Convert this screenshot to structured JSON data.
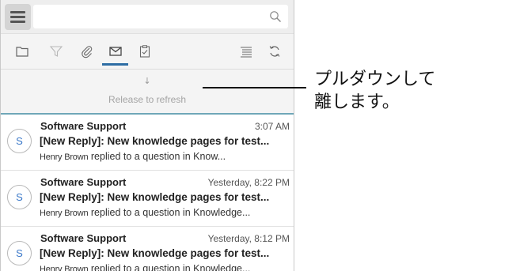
{
  "search": {
    "placeholder": ""
  },
  "toolbar": {
    "icons": [
      "folder-icon",
      "filter-icon",
      "paperclip-icon",
      "envelope-icon",
      "clipboard-icon",
      "list-icon",
      "refresh-icon"
    ],
    "active_tab": "envelope-icon",
    "accent": "#2e6da4"
  },
  "pull_to_refresh": {
    "arrow": "↓",
    "label": "Release to refresh",
    "divider_color": "#6fa7b8"
  },
  "messages": [
    {
      "avatar": "S",
      "sender": "Software Support",
      "time": "3:07 AM",
      "subject": "[New Reply]: New knowledge pages for test...",
      "preview_name": "Henry Brown",
      "preview_text": "replied to a question in Know..."
    },
    {
      "avatar": "S",
      "sender": "Software Support",
      "time": "Yesterday, 8:22 PM",
      "subject": "[New Reply]: New knowledge pages for test...",
      "preview_name": "Henry Brown",
      "preview_text": "replied to a question in Knowledge..."
    },
    {
      "avatar": "S",
      "sender": "Software Support",
      "time": "Yesterday, 8:12 PM",
      "subject": "[New Reply]: New knowledge pages for test...",
      "preview_name": "Henry Brown",
      "preview_text": "replied to a question in Knowledge..."
    }
  ],
  "callout": {
    "text": "プルダウンして\n離します。"
  }
}
